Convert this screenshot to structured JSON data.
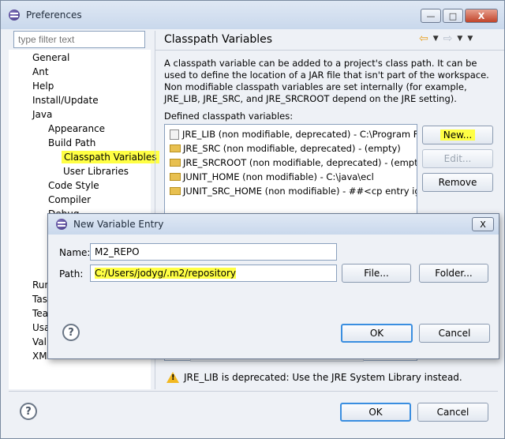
{
  "window": {
    "title": "Preferences",
    "minimize_label": "—",
    "maximize_label": "□",
    "close_label": "X"
  },
  "filter": {
    "placeholder": "type filter text"
  },
  "tree": {
    "items": [
      {
        "label": "General"
      },
      {
        "label": "Ant"
      },
      {
        "label": "Help"
      },
      {
        "label": "Install/Update"
      },
      {
        "label": "Java"
      },
      {
        "label": "Appearance"
      },
      {
        "label": "Build Path"
      },
      {
        "label": "Classpath Variables"
      },
      {
        "label": "User Libraries"
      },
      {
        "label": "Code Style"
      },
      {
        "label": "Compiler"
      },
      {
        "label": "Debug"
      },
      {
        "label": "Run"
      },
      {
        "label": "Task"
      },
      {
        "label": "Tea"
      },
      {
        "label": "Usa"
      },
      {
        "label": "Vali"
      },
      {
        "label": "XML"
      }
    ]
  },
  "page": {
    "title": "Classpath Variables",
    "description": "A classpath variable can be added to a project's class path. It can be used to define the location of a JAR file that isn't part of the workspace. Non modifiable classpath variables are set internally (for example, JRE_LIB, JRE_SRC, and JRE_SRCROOT depend on the JRE setting).",
    "defined_label": "Defined classpath variables:",
    "variables": [
      {
        "label": "JRE_LIB (non modifiable, deprecated) - C:\\Program Files\\"
      },
      {
        "label": "JRE_SRC (non modifiable, deprecated) - (empty)"
      },
      {
        "label": "JRE_SRCROOT (non modifiable, deprecated) - (empty)"
      },
      {
        "label": "JUNIT_HOME (non modifiable) - C:\\java\\ecl"
      },
      {
        "label": "JUNIT_SRC_HOME (non modifiable) - ##<cp entry ignor"
      }
    ],
    "buttons": {
      "new": "New...",
      "edit": "Edit...",
      "remove": "Remove"
    },
    "warning": "JRE_LIB is deprecated: Use the JRE System Library instead."
  },
  "footer": {
    "help": "?",
    "ok": "OK",
    "cancel": "Cancel"
  },
  "dialog": {
    "title": "New Variable Entry",
    "close_label": "X",
    "name_label": "Name:",
    "name_value": "M2_REPO",
    "path_label": "Path:",
    "path_value": "C:/Users/jodyg/.m2/repository",
    "file_button": "File...",
    "folder_button": "Folder...",
    "help": "?",
    "ok": "OK",
    "cancel": "Cancel"
  },
  "colors": {
    "highlight": "#ffff44",
    "default_button_border": "#3a8ee0"
  }
}
